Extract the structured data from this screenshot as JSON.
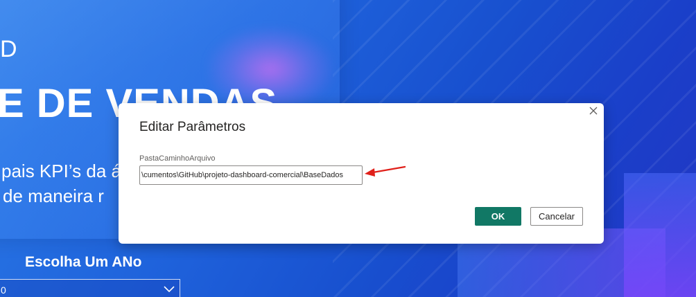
{
  "background": {
    "heading_partial": "D",
    "title_partial": "E DE VENDAS",
    "kpi_line1": "pais KPI’s da á",
    "kpi_line2": "de maneira r",
    "choose_year_label": "Escolha Um ANo",
    "dropdown_value": "0"
  },
  "dialog": {
    "title": "Editar Parâmetros",
    "field_label": "PastaCaminhoArquivo",
    "field_value": "cumentos\\GitHub\\projeto-dashboard-comercial\\BaseDados\\",
    "ok_label": "OK",
    "cancel_label": "Cancelar"
  },
  "colors": {
    "accent_ok": "#117865",
    "annotation_arrow": "#e0201a"
  },
  "icons": {
    "close": "close-icon",
    "dropdown": "chevron-down-icon",
    "annotation": "red-arrow-icon"
  }
}
